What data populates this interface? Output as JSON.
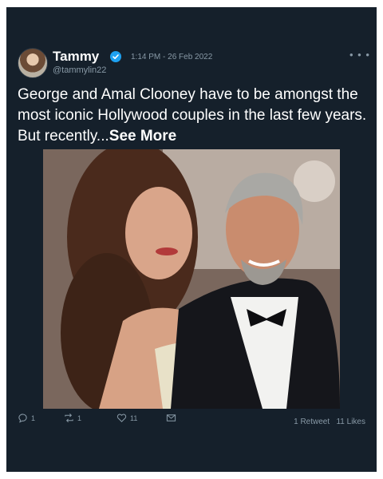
{
  "tweet": {
    "author_name": "Tammy",
    "author_handle": "@tammylin22",
    "timestamp": "1:14 PM - 26 Feb 2022",
    "more_menu": "• • •",
    "text": "George and Amal Clooney have to be amongst the most iconic Hollywood couples in the last few years. But recently...",
    "see_more": "See More"
  },
  "actions": {
    "reply_count": "1",
    "retweet_count": "1",
    "like_count": "11"
  },
  "stats": {
    "retweets": "1 Retweet",
    "likes": "11 Likes"
  },
  "icons": {
    "verified": "verified-badge-icon",
    "reply": "reply-icon",
    "retweet": "retweet-icon",
    "like": "heart-icon",
    "dm": "message-icon"
  },
  "colors": {
    "card_background": "#15202b",
    "secondary_text": "#8899a6",
    "verified_blue": "#1da1f2"
  }
}
